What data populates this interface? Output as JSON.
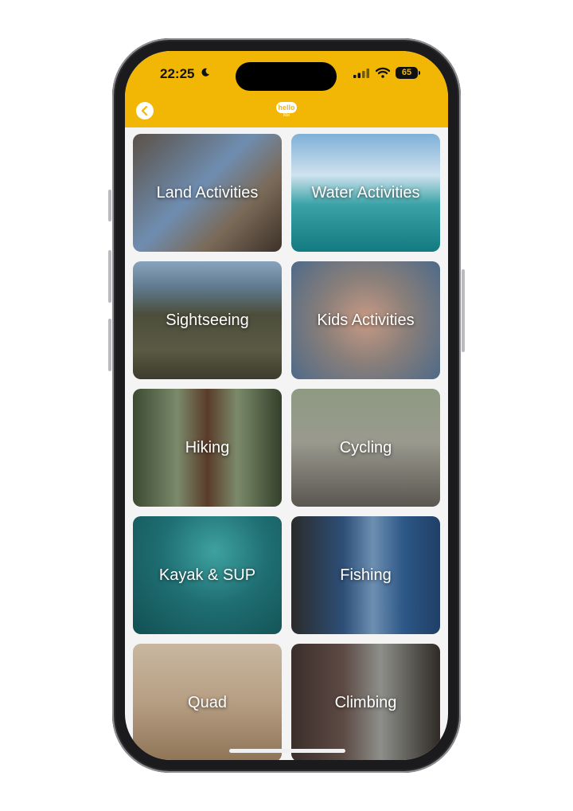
{
  "status_bar": {
    "time": "22:25",
    "battery": "65"
  },
  "header": {
    "logo_text": "hello",
    "logo_subtext": "Kiki"
  },
  "activities": [
    {
      "label": "Land Activities",
      "id": "land-activities"
    },
    {
      "label": "Water Activities",
      "id": "water-activities"
    },
    {
      "label": "Sightseeing",
      "id": "sightseeing"
    },
    {
      "label": "Kids Activities",
      "id": "kids-activities"
    },
    {
      "label": "Hiking",
      "id": "hiking"
    },
    {
      "label": "Cycling",
      "id": "cycling"
    },
    {
      "label": "Kayak & SUP",
      "id": "kayak-sup"
    },
    {
      "label": "Fishing",
      "id": "fishing"
    },
    {
      "label": "Quad",
      "id": "quad"
    },
    {
      "label": "Climbing",
      "id": "climbing"
    }
  ],
  "colors": {
    "header_bg": "#f2b705"
  }
}
